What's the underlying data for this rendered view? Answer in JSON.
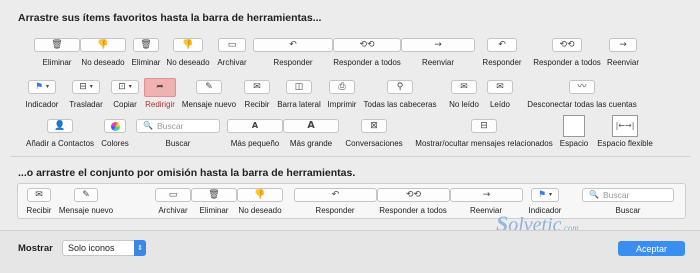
{
  "heading_top": "Arrastre sus ítems favoritos hasta la barra de herramientas...",
  "heading_default": "...o arrastre el conjunto por omisión hasta la barra de herramientas.",
  "row1": {
    "labels": {
      "eliminar": "Eliminar",
      "no_deseado": "No deseado",
      "eliminar2": "Eliminar",
      "no_deseado2": "No deseado",
      "archivar": "Archivar",
      "responder": "Responder",
      "responder_todos": "Responder a todos",
      "reenviar": "Reenviar",
      "responder2": "Responder",
      "responder_todos2": "Responder a todos",
      "reenviar2": "Reenviar"
    }
  },
  "row2": {
    "labels": {
      "indicador": "Indicador",
      "trasladar": "Trasladar",
      "copiar": "Copiar",
      "redirigir": "Redirigir",
      "mensaje_nuevo": "Mensaje nuevo",
      "recibir": "Recibir",
      "barra_lateral": "Barra lateral",
      "imprimir": "Imprimir",
      "todas_cabeceras": "Todas las cabeceras",
      "no_leido": "No leído",
      "leido": "Leído",
      "desconectar": "Desconectar todas las cuentas"
    }
  },
  "row3": {
    "search_placeholder": "Buscar",
    "labels": {
      "anadir_contactos": "Añadir a Contactos",
      "colores": "Colores",
      "buscar": "Buscar",
      "mas_pequeno": "Más pequeño",
      "mas_grande": "Más grande",
      "conversaciones": "Conversaciones",
      "mostrar_ocultar": "Mostrar/ocultar mensajes relacionados",
      "espacio": "Espacio",
      "espacio_flexible": "Espacio flexible"
    }
  },
  "default_set": {
    "search_placeholder": "Buscar",
    "labels": {
      "recibir": "Recibir",
      "mensaje_nuevo": "Mensaje nuevo",
      "archivar": "Archivar",
      "eliminar": "Eliminar",
      "no_deseado": "No deseado",
      "responder": "Responder",
      "responder_todos": "Responder a todos",
      "reenviar": "Reenviar",
      "indicador": "Indicador",
      "buscar": "Buscar"
    }
  },
  "bottom": {
    "mostrar_label": "Mostrar",
    "select_value": "Solo iconos",
    "accept_label": "Aceptar"
  },
  "watermark": {
    "text": "olvetic",
    "suffix": ".com"
  },
  "colors": {
    "accent": "#3a8ef0",
    "selected_item": "#f0b1b1",
    "flag_blue": "#2f7de1"
  }
}
